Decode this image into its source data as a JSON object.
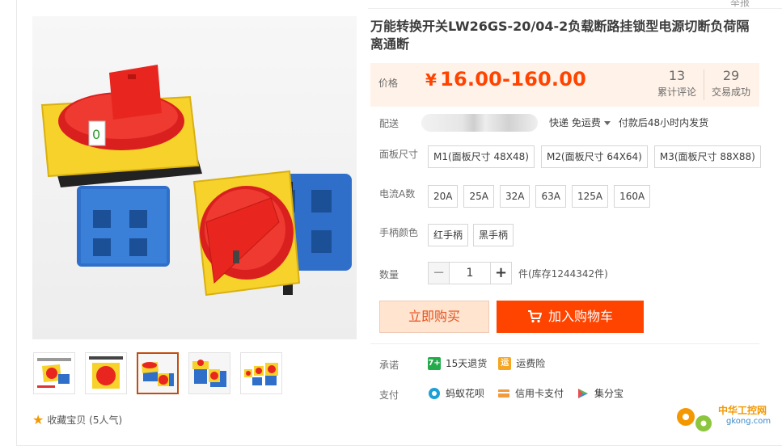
{
  "header": {
    "report": "举报"
  },
  "product": {
    "title": "万能转换开关LW26GS-20/04-2负载断路挂锁型电源切断负荷隔离通断"
  },
  "price": {
    "label": "价格",
    "currency": "¥",
    "value": "16.00-160.00",
    "reviews_count": "13",
    "reviews_label": "累计评论",
    "deals_count": "29",
    "deals_label": "交易成功"
  },
  "shipping": {
    "label": "配送",
    "method": "快递 免运费",
    "note": "付款后48小时内发货"
  },
  "options": {
    "panel_label": "面板尺寸",
    "panel": [
      "M1(面板尺寸 48X48)",
      "M2(面板尺寸 64X64)",
      "M3(面板尺寸 88X88)"
    ],
    "current_label": "电流A数",
    "current": [
      "20A",
      "25A",
      "32A",
      "63A",
      "125A",
      "160A"
    ],
    "handle_label": "手柄颜色",
    "handle": [
      "红手柄",
      "黑手柄"
    ]
  },
  "quantity": {
    "label": "数量",
    "minus": "−",
    "value": "1",
    "plus": "+",
    "stock": "件(库存1244342件)"
  },
  "actions": {
    "buy_now": "立即购买",
    "add_cart": "加入购物车"
  },
  "promise": {
    "label": "承诺",
    "items": [
      {
        "text": "15天退货",
        "badge": "7+",
        "color": "#23ab4b"
      },
      {
        "text": "运费险",
        "badge": "运",
        "color": "#f5a623"
      }
    ]
  },
  "payment": {
    "label": "支付",
    "items": [
      {
        "text": "蚂蚁花呗",
        "icon": "huabei-icon",
        "color": "#1f9fd7"
      },
      {
        "text": "信用卡支付",
        "icon": "credit-card-icon",
        "color": "#f39a3d"
      },
      {
        "text": "集分宝",
        "icon": "jifenbao-icon",
        "color": "#5cb85c"
      }
    ]
  },
  "favorite": {
    "text": "收藏宝贝 (5人气)"
  },
  "watermark": {
    "cn": "中华工控网",
    "url": "gkong.com"
  },
  "colors": {
    "accent": "#ff4400",
    "price_bg": "#fff2e8",
    "buy_bg": "#ffe4d0"
  }
}
